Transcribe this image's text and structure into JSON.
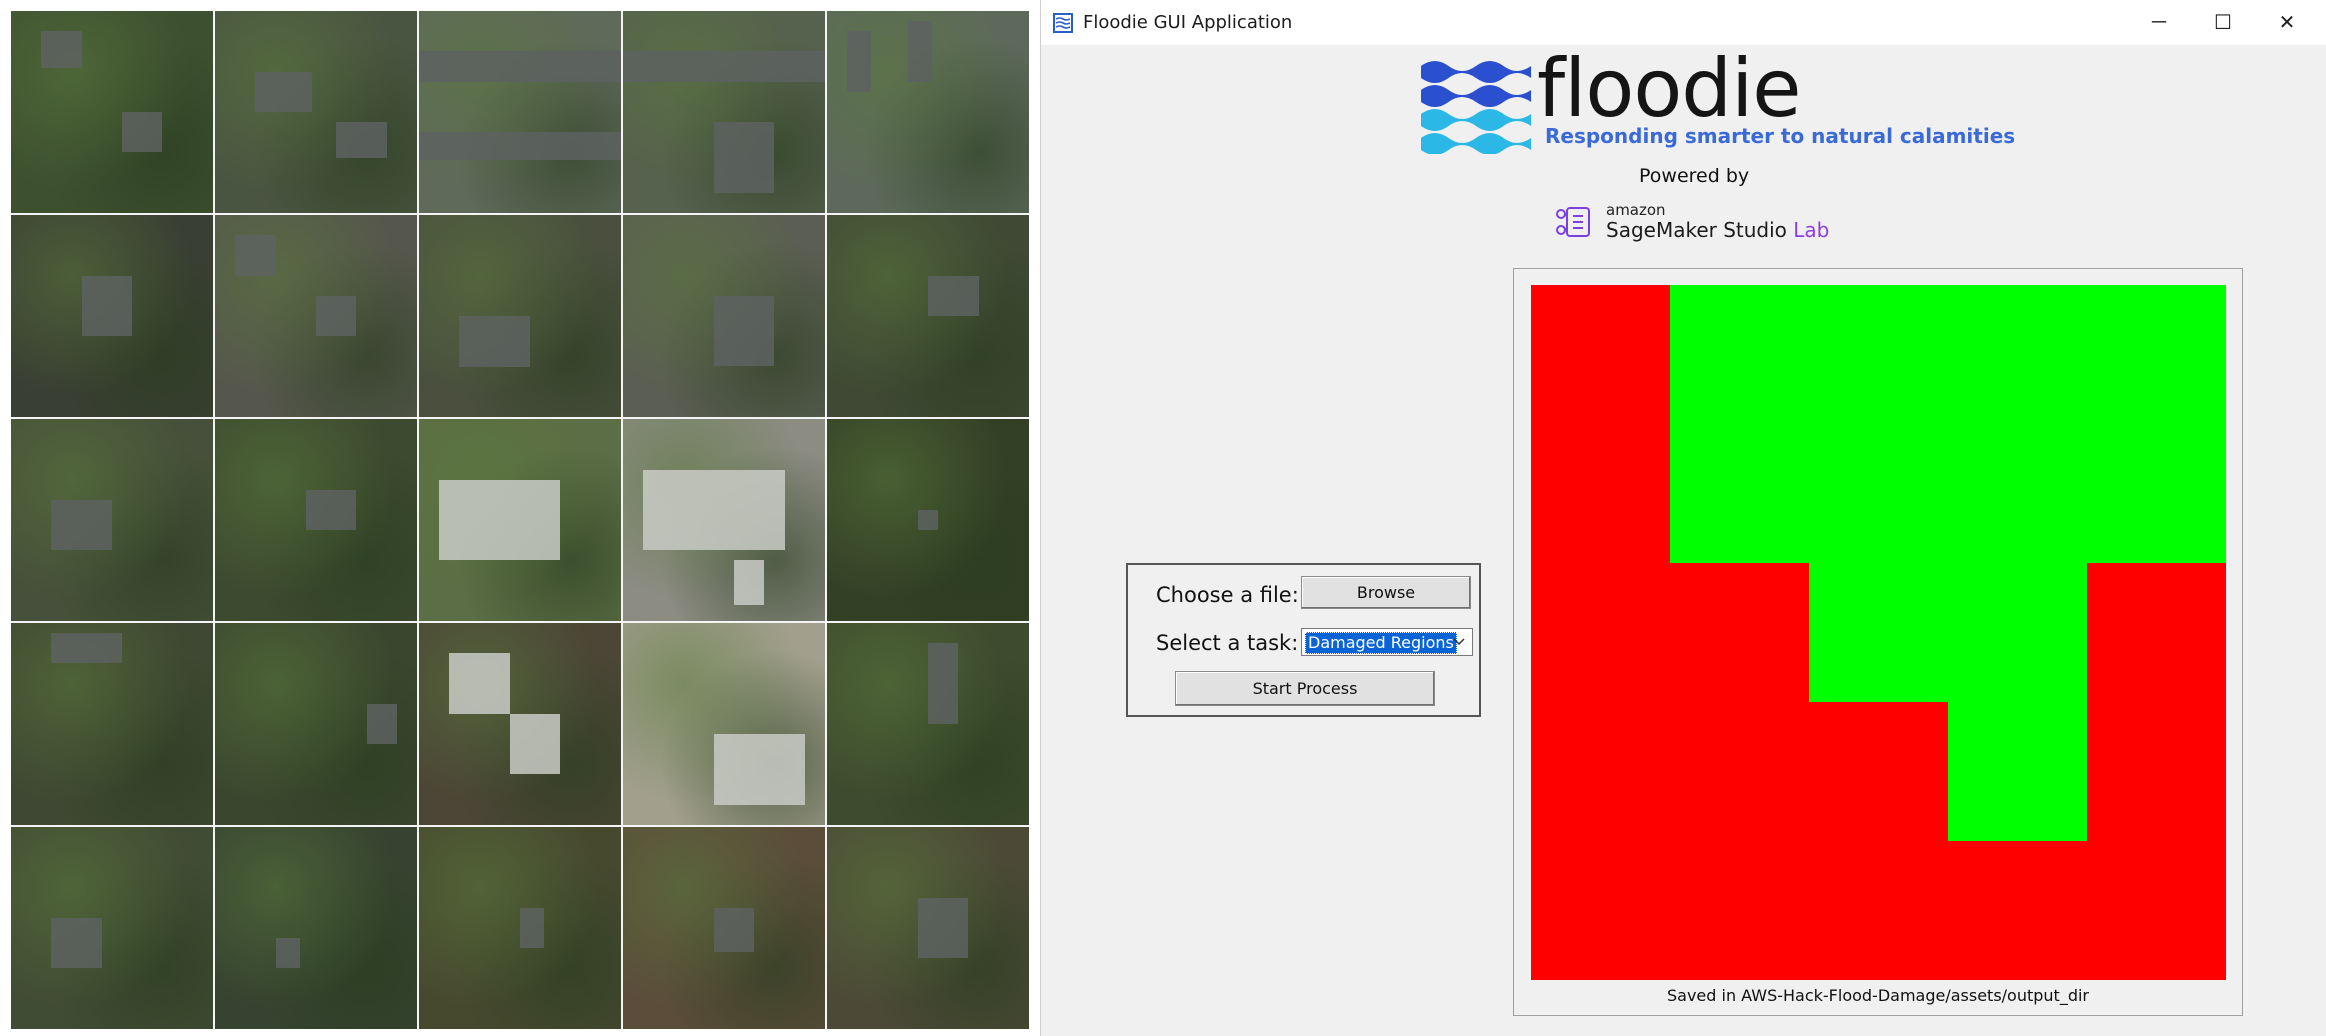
{
  "window": {
    "title": "Floodie GUI Application",
    "controls": {
      "minimize": "─",
      "maximize": "☐",
      "close": "✕"
    }
  },
  "branding": {
    "logo_text": "floodie",
    "tagline": "Responding smarter to natural calamities",
    "powered_by": "Powered by",
    "partner_small": "amazon",
    "partner_name": "SageMaker Studio",
    "partner_suffix": "Lab",
    "colors": {
      "wave_dark": "#2a4fcf",
      "wave_light": "#2bb8e6",
      "tagline": "#3a69d8",
      "lab": "#8e3fe0"
    }
  },
  "form": {
    "file_label": "Choose a file:",
    "browse_button": "Browse",
    "task_label": "Select a task:",
    "task_selected": "Damaged Regions",
    "start_button": "Start Process"
  },
  "output": {
    "caption": "Saved in AWS-Hack-Flood-Damage/assets/output_dir",
    "legend_colors": {
      "damaged": "#ff0000",
      "undamaged": "#00ff00"
    },
    "grid": [
      [
        "damaged",
        "undamaged",
        "undamaged",
        "undamaged",
        "undamaged"
      ],
      [
        "damaged",
        "undamaged",
        "undamaged",
        "undamaged",
        "undamaged"
      ],
      [
        "damaged",
        "damaged",
        "undamaged",
        "undamaged",
        "damaged"
      ],
      [
        "damaged",
        "damaged",
        "damaged",
        "undamaged",
        "damaged"
      ],
      [
        "damaged",
        "damaged",
        "damaged",
        "damaged",
        "damaged"
      ]
    ]
  },
  "mosaic": {
    "tiles": [
      "#3d5030",
      "#4a5541",
      "#5f6a5a",
      "#56614e",
      "#5d6a5b",
      "#3a3f33",
      "#56574c",
      "#4a4f3e",
      "#5b5e52",
      "#3f4934",
      "#46503a",
      "#3c4a2f",
      "#5c6e45",
      "#8c8c82",
      "#334026",
      "#3f4832",
      "#3a472e",
      "#4b4636",
      "#a2a08d",
      "#3d4b2e",
      "#414c34",
      "#364330",
      "#47492f",
      "#5b4d3a",
      "#4c4a36"
    ]
  }
}
